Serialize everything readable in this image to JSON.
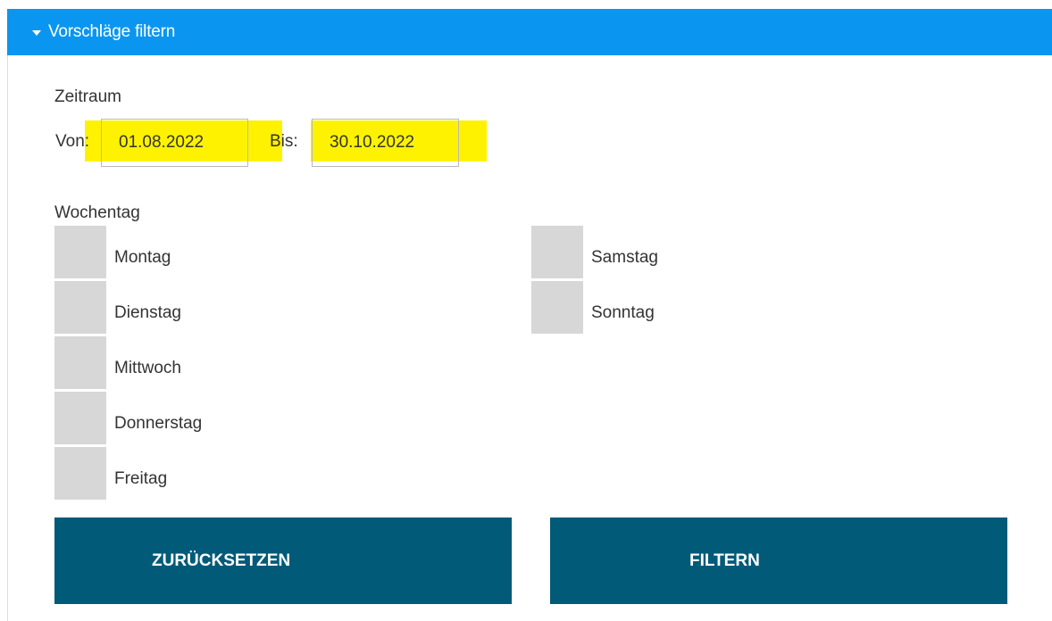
{
  "header": {
    "title": "Vorschläge filtern",
    "color": "#0a96f0"
  },
  "zeitraum": {
    "label": "Zeitraum",
    "von_label": "Von:",
    "von_value": "01.08.2022",
    "bis_label": "Bis:",
    "bis_value": "30.10.2022",
    "highlight_color": "#fff200"
  },
  "wochentag": {
    "label": "Wochentag",
    "days": [
      {
        "label": "Montag",
        "checked": false
      },
      {
        "label": "Dienstag",
        "checked": false
      },
      {
        "label": "Mittwoch",
        "checked": false
      },
      {
        "label": "Donnerstag",
        "checked": false
      },
      {
        "label": "Freitag",
        "checked": false
      },
      {
        "label": "Samstag",
        "checked": false
      },
      {
        "label": "Sonntag",
        "checked": false
      }
    ]
  },
  "buttons": {
    "reset_label": "ZURÜCKSETZEN",
    "filter_label": "FILTERN",
    "color": "#005a78"
  }
}
